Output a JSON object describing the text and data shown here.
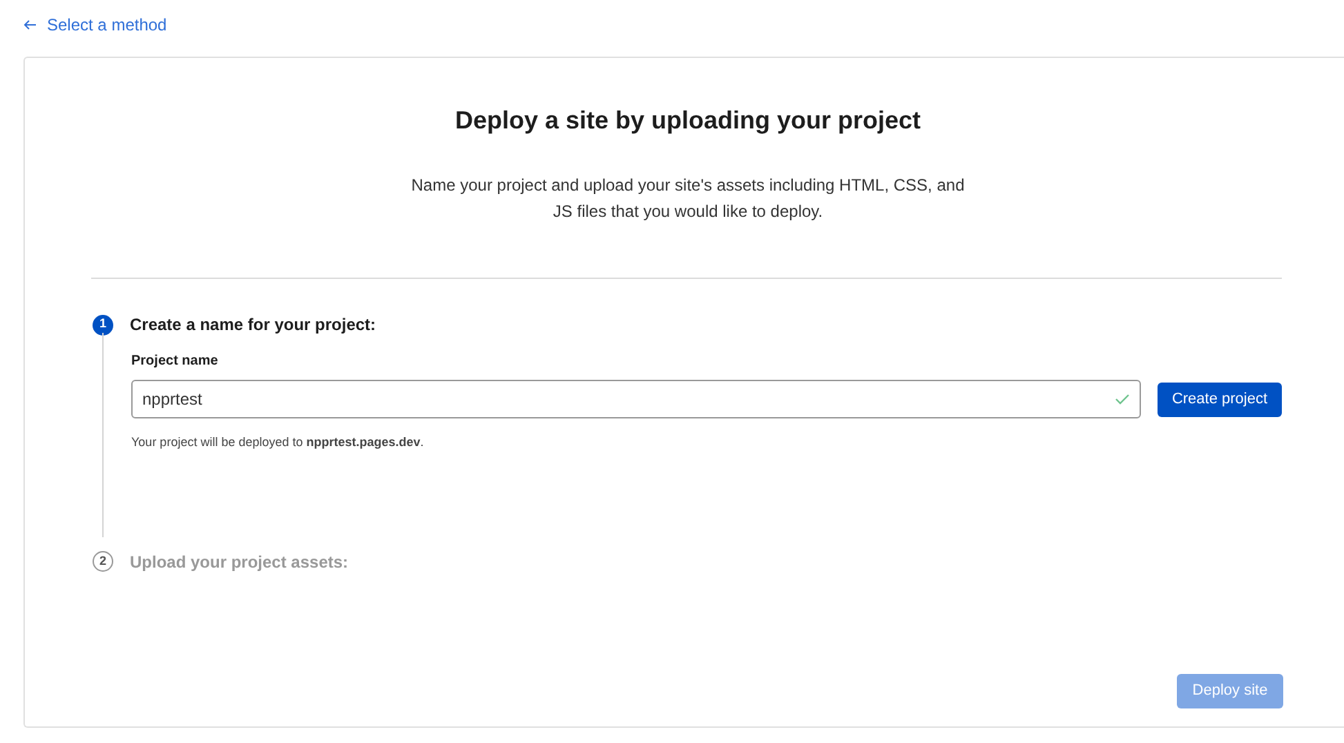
{
  "back_link": {
    "label": "Select a method"
  },
  "title": "Deploy a site by uploading your project",
  "description": "Name your project and upload your site's assets including HTML, CSS, and JS files that you would like to deploy.",
  "steps": [
    {
      "number": "1",
      "heading": "Create a name for your project:",
      "active": true
    },
    {
      "number": "2",
      "heading": "Upload your project assets:",
      "active": false
    }
  ],
  "project_name": {
    "label": "Project name",
    "value": "npprtest",
    "valid": true,
    "hint": "Your project will be deployed to **npprtest.pages.dev**."
  },
  "create_button": {
    "label": "Create project",
    "disabled": false
  },
  "deploy_button": {
    "label": "Deploy site",
    "disabled": true
  }
}
